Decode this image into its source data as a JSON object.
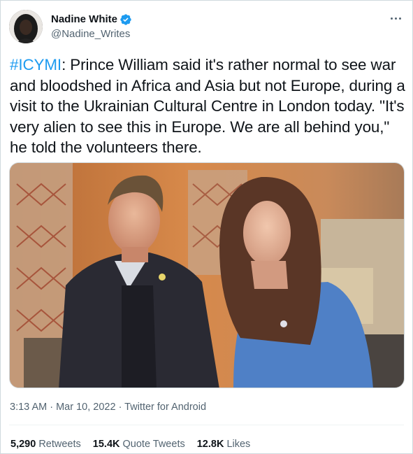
{
  "author": {
    "display_name": "Nadine White",
    "handle": "@Nadine_Writes",
    "verified": true
  },
  "tweet": {
    "hashtag": "#ICYMI",
    "body": ": Prince William said it's rather normal to see war and bloodshed in Africa and Asia but not Europe, during a visit to the Ukrainian Cultural Centre in London today. \"It's very alien to see this in Europe. We are all behind you,\" he told the volunteers there."
  },
  "meta": {
    "time": "3:13 AM",
    "sep1": " · ",
    "date": "Mar 10, 2022",
    "sep2": " · ",
    "source": "Twitter for Android"
  },
  "stats": {
    "retweets_count": "5,290",
    "retweets_label": "Retweets",
    "quotes_count": "15.4K",
    "quotes_label": "Quote Tweets",
    "likes_count": "12.8K",
    "likes_label": "Likes"
  },
  "colors": {
    "link": "#1d9bf0",
    "secondary_text": "#536471",
    "verified_badge": "#1d9bf0"
  },
  "icons": {
    "verified": "verified-badge-icon",
    "more": "more-options-icon"
  }
}
